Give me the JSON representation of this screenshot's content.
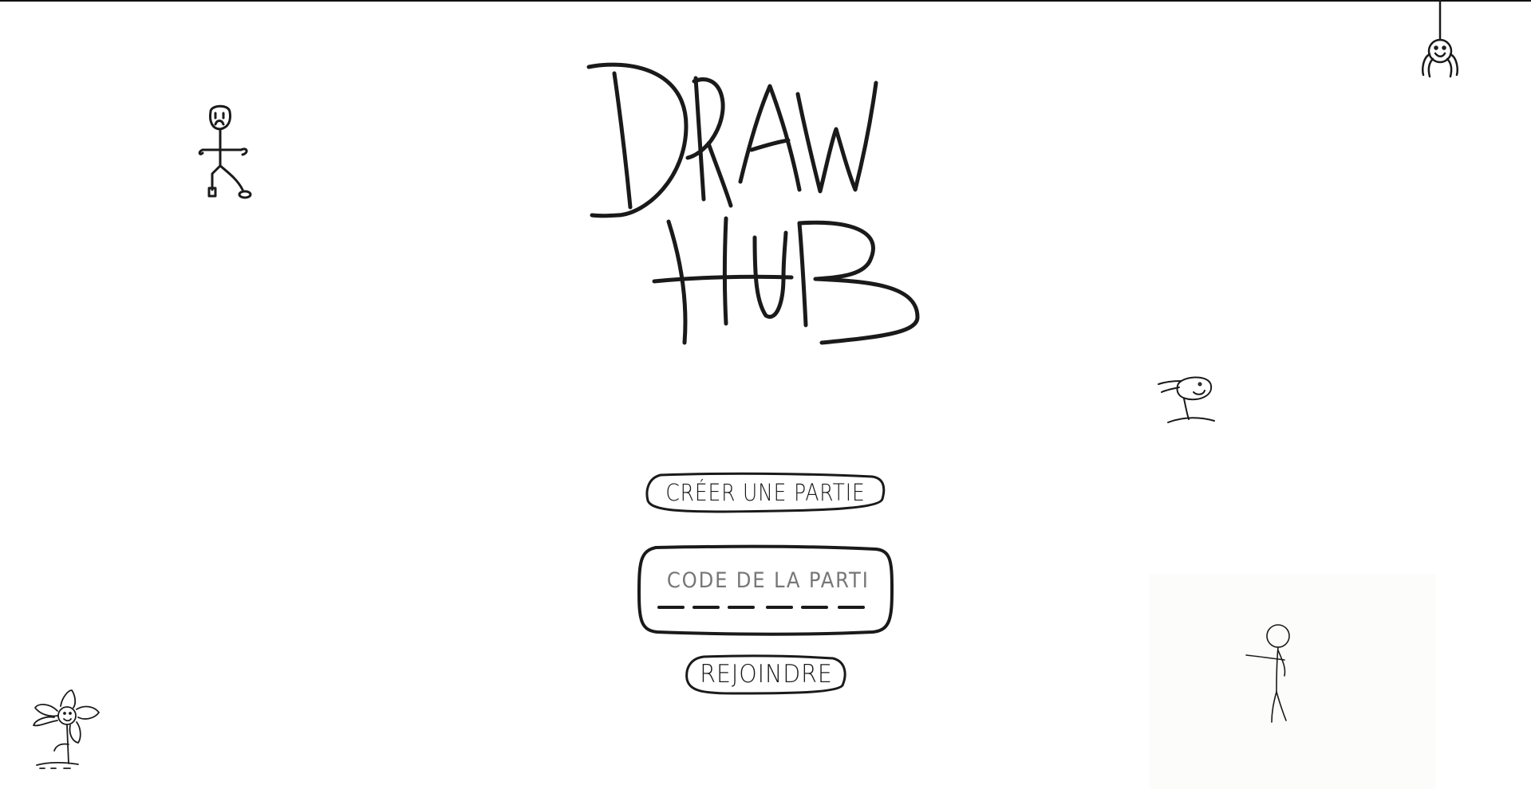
{
  "title": {
    "line1": "DRAW",
    "line2": "HUB"
  },
  "actions": {
    "create_label": "CRÉER UNE PARTIE",
    "join_label": "REJOINDRE"
  },
  "code_input": {
    "placeholder": "CODE DE LA PARTIE",
    "value": ""
  },
  "icons": {
    "sad_stickman": "stickman-sad-doodle",
    "spider": "spider-doodle",
    "mushroom_creature": "mushroom-creature-doodle",
    "flower": "flower-doodle",
    "pointing_stickman": "stickman-pointing-doodle"
  },
  "colors": {
    "ink": "#1a1a1a",
    "background": "#ffffff",
    "placeholder": "#777777"
  }
}
